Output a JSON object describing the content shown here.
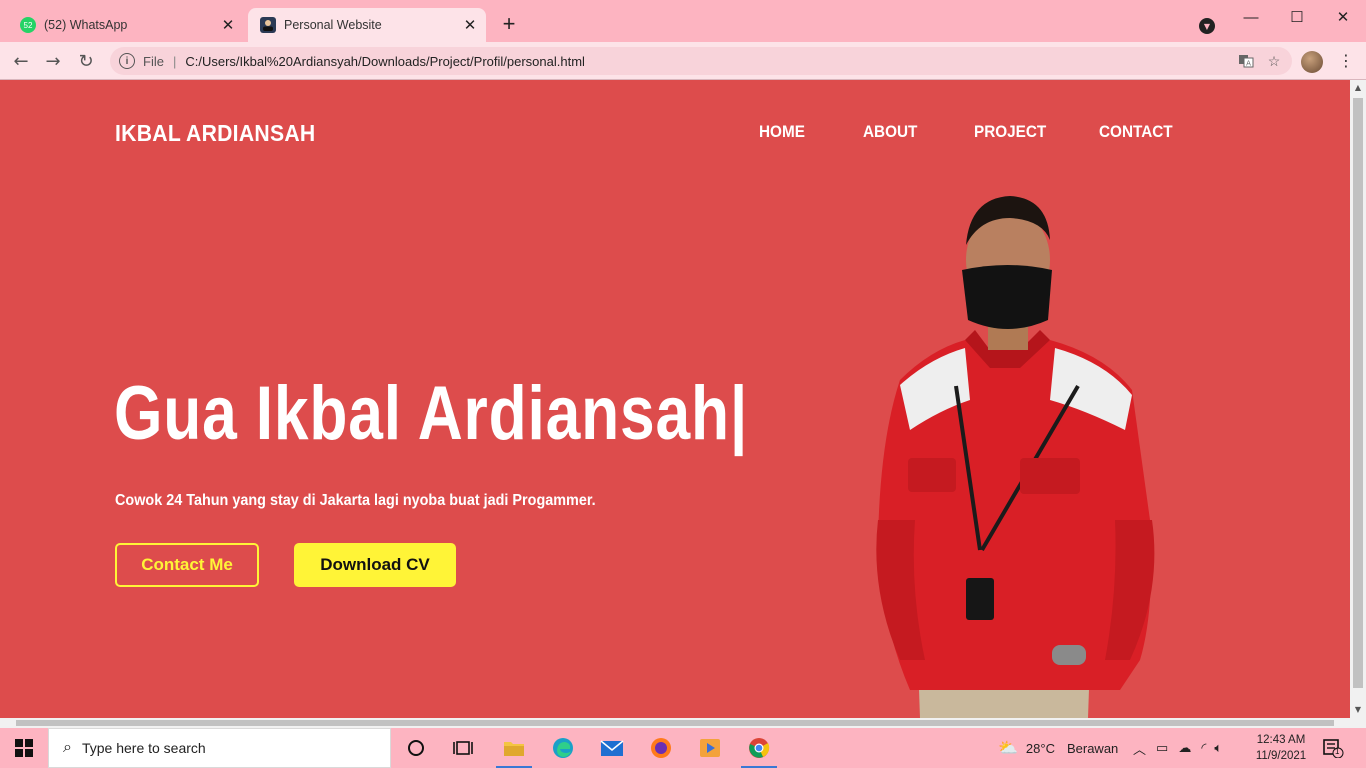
{
  "browser": {
    "tabs": [
      {
        "title": "(52) WhatsApp",
        "badge": "52",
        "active": false
      },
      {
        "title": "Personal Website",
        "active": true
      }
    ],
    "address": {
      "scheme": "File",
      "url": "C:/Users/Ikbal%20Ardiansyah/Downloads/Project/Profil/personal.html"
    }
  },
  "site": {
    "brand": "IKBAL ARDIANSAH",
    "nav": [
      "HOME",
      "ABOUT",
      "PROJECT",
      "CONTACT"
    ],
    "hero_title": "Gua Ikbal Ardiansah|",
    "hero_subtitle": "Cowok 24 Tahun yang stay di Jakarta lagi nyoba buat jadi Progammer.",
    "buttons": {
      "contact": "Contact Me",
      "cv": "Download CV"
    },
    "colors": {
      "background": "#dd4c4c",
      "accent": "#fff437",
      "text": "#ffffff"
    }
  },
  "taskbar": {
    "search_placeholder": "Type here to search",
    "weather": {
      "temp": "28°C",
      "condition": "Berawan"
    },
    "clock": {
      "time": "12:43 AM",
      "date": "11/9/2021"
    },
    "notifications": "1"
  }
}
